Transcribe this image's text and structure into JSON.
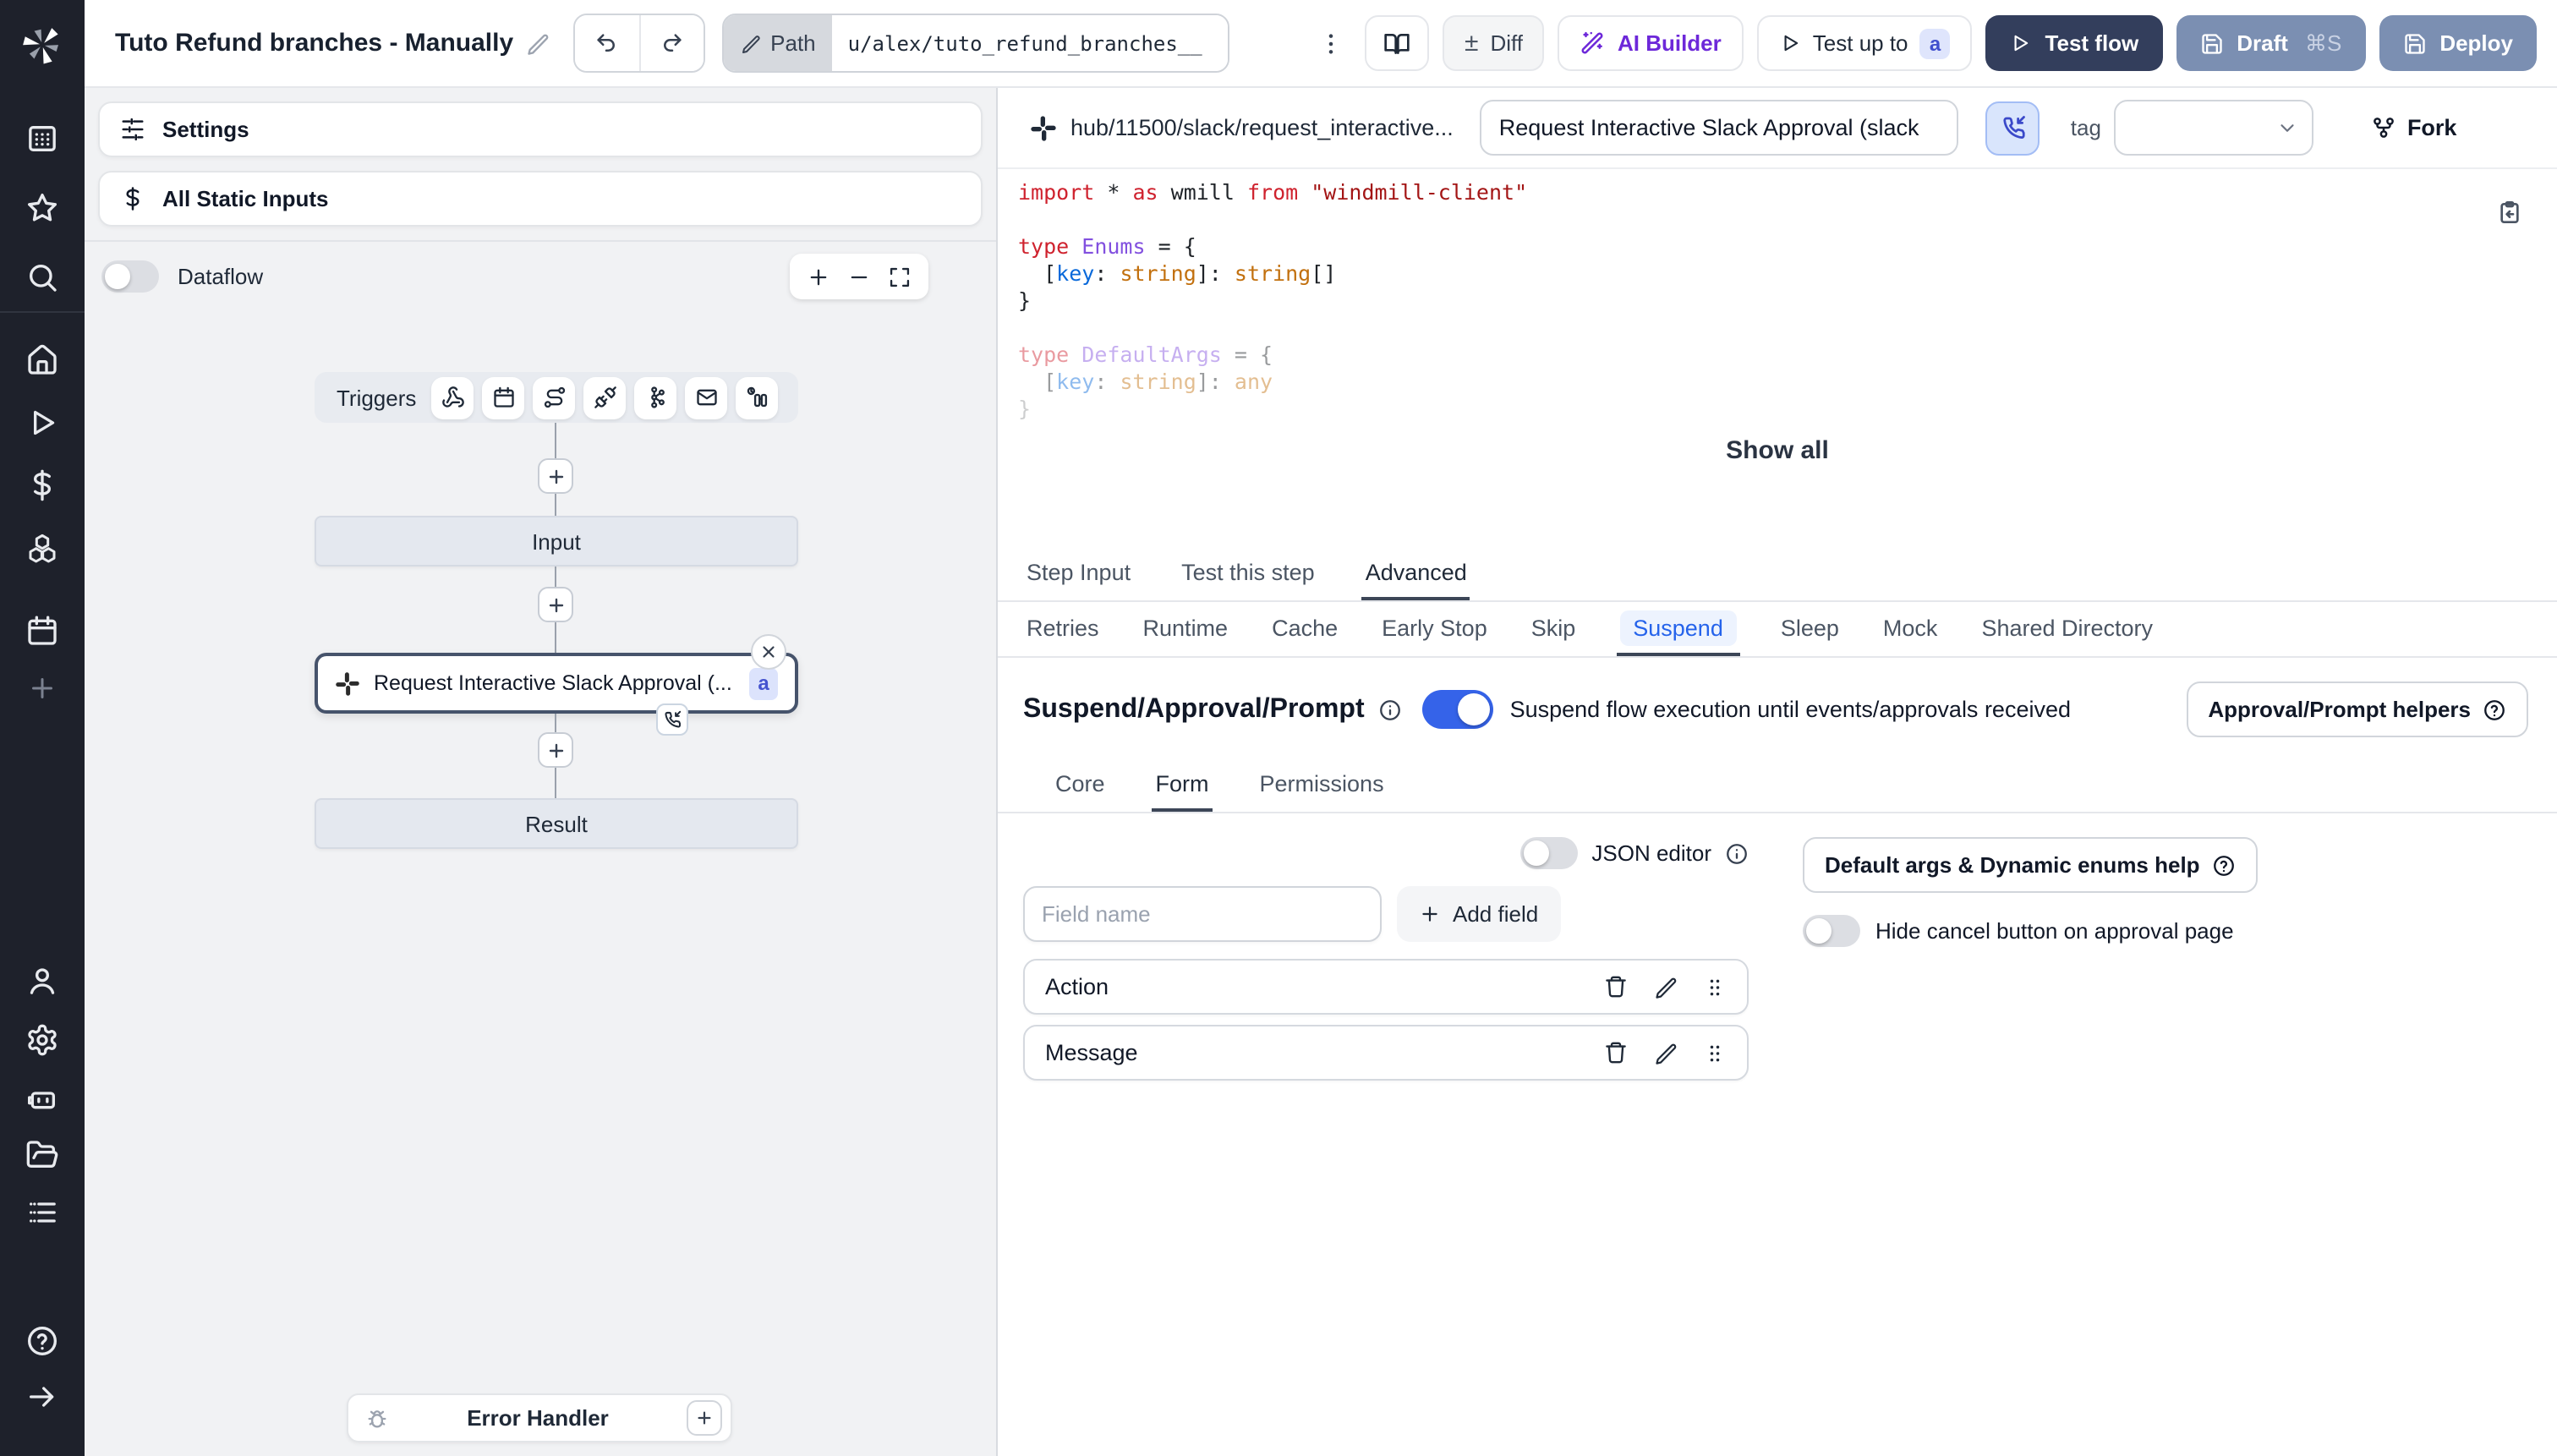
{
  "topbar": {
    "title": "Tuto Refund branches - Manually",
    "path_label": "Path",
    "path_value": "u/alex/tuto_refund_branches__",
    "diff_label": "Diff",
    "ai_builder_label": "AI Builder",
    "test_up_to_label": "Test up to",
    "test_up_to_badge": "a",
    "test_flow_label": "Test flow",
    "draft_label": "Draft",
    "draft_shortcut": "⌘S",
    "deploy_label": "Deploy"
  },
  "sidebar": {
    "icons": [
      "windmill-logo",
      "workspace-icon",
      "favorites-icon",
      "search-icon",
      "home-icon",
      "runs-icon",
      "variables-icon",
      "resources-icon",
      "schedules-icon",
      "add-icon",
      "users-icon",
      "settings-icon",
      "ai-icon",
      "folders-icon",
      "audit-logs-icon",
      "help-icon",
      "collapse-sidebar-icon"
    ]
  },
  "flow": {
    "settings_label": "Settings",
    "static_inputs_label": "All Static Inputs",
    "dataflow_label": "Dataflow",
    "triggers_label": "Triggers",
    "trigger_icons": [
      "webhook-icon",
      "schedule-icon",
      "http-route-icon",
      "websocket-icon",
      "kafka-icon",
      "email-icon",
      "scheduled-poll-icon"
    ],
    "input_label": "Input",
    "step_label": "Request Interactive Slack Approval (...",
    "step_badge": "a",
    "result_label": "Result",
    "error_handler_label": "Error Handler"
  },
  "panel": {
    "header": {
      "hub_path": "hub/11500/slack/request_interactive...",
      "title_value": "Request Interactive Slack Approval (slack",
      "tag_label": "tag",
      "fork_label": "Fork"
    },
    "code": {
      "lines": [
        {
          "tokens": [
            {
              "t": "import",
              "c": "kw"
            },
            {
              "t": " * ",
              "c": "pl"
            },
            {
              "t": "as",
              "c": "kw"
            },
            {
              "t": " wmill ",
              "c": "pl"
            },
            {
              "t": "from",
              "c": "kw"
            },
            {
              "t": " ",
              "c": "pl"
            },
            {
              "t": "\"windmill-client\"",
              "c": "str"
            }
          ]
        },
        {
          "tokens": []
        },
        {
          "tokens": [
            {
              "t": "type",
              "c": "kw"
            },
            {
              "t": " ",
              "c": "pl"
            },
            {
              "t": "Enums",
              "c": "ty"
            },
            {
              "t": " = {",
              "c": "pl"
            }
          ]
        },
        {
          "tokens": [
            {
              "t": "  [",
              "c": "pl"
            },
            {
              "t": "key",
              "c": "vr"
            },
            {
              "t": ": ",
              "c": "pl"
            },
            {
              "t": "string",
              "c": "or"
            },
            {
              "t": "]: ",
              "c": "pl"
            },
            {
              "t": "string",
              "c": "or"
            },
            {
              "t": "[]",
              "c": "pl"
            }
          ]
        },
        {
          "tokens": [
            {
              "t": "}",
              "c": "pl"
            }
          ]
        },
        {
          "tokens": []
        },
        {
          "tokens": [
            {
              "t": "type",
              "c": "kw"
            },
            {
              "t": " ",
              "c": "pl"
            },
            {
              "t": "DefaultArgs",
              "c": "ty"
            },
            {
              "t": " = {",
              "c": "pl"
            }
          ],
          "fade": 1
        },
        {
          "tokens": [
            {
              "t": "  [",
              "c": "pl"
            },
            {
              "t": "key",
              "c": "vr"
            },
            {
              "t": ": ",
              "c": "pl"
            },
            {
              "t": "string",
              "c": "or"
            },
            {
              "t": "]: ",
              "c": "pl"
            },
            {
              "t": "any",
              "c": "or"
            }
          ],
          "fade": 1
        },
        {
          "tokens": [
            {
              "t": "}",
              "c": "pl"
            }
          ],
          "fade": 2
        }
      ]
    },
    "show_all_label": "Show all",
    "tabs": [
      "Step Input",
      "Test this step",
      "Advanced"
    ],
    "active_tab": "Advanced",
    "subtabs": [
      "Retries",
      "Runtime",
      "Cache",
      "Early Stop",
      "Skip",
      "Suspend",
      "Sleep",
      "Mock",
      "Shared Directory"
    ],
    "active_subtab": "Suspend",
    "suspend": {
      "heading": "Suspend/Approval/Prompt",
      "toggle_label": "Suspend flow execution until events/approvals received",
      "helpers_label": "Approval/Prompt helpers",
      "form_tabs": [
        "Core",
        "Form",
        "Permissions"
      ],
      "active_form_tab": "Form",
      "json_editor_label": "JSON editor",
      "field_name_placeholder": "Field name",
      "add_field_label": "Add field",
      "fields": [
        "Action",
        "Message"
      ],
      "default_args_label": "Default args & Dynamic enums help",
      "hide_cancel_label": "Hide cancel button on approval page"
    }
  },
  "colors": {
    "accent_blue": "#3563e9",
    "sidebar_bg": "#1e212b",
    "test_flow_bg": "#333e5c",
    "draft_deploy_bg": "#7b8fb2",
    "badge_bg": "#dfe5fc",
    "badge_text": "#4150ce",
    "ai_builder_purple": "#6d28d9",
    "suspend_tab_blue": "#2563eb"
  }
}
